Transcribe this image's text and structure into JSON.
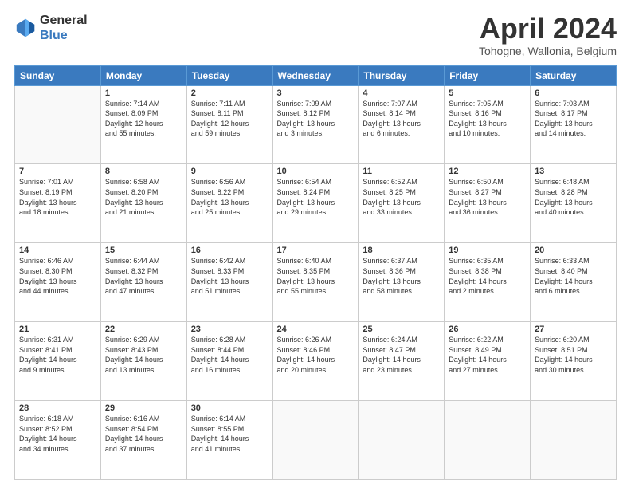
{
  "logo": {
    "line1": "General",
    "line2": "Blue"
  },
  "title": "April 2024",
  "subtitle": "Tohogne, Wallonia, Belgium",
  "header_days": [
    "Sunday",
    "Monday",
    "Tuesday",
    "Wednesday",
    "Thursday",
    "Friday",
    "Saturday"
  ],
  "weeks": [
    [
      {
        "day": "",
        "info": ""
      },
      {
        "day": "1",
        "info": "Sunrise: 7:14 AM\nSunset: 8:09 PM\nDaylight: 12 hours\nand 55 minutes."
      },
      {
        "day": "2",
        "info": "Sunrise: 7:11 AM\nSunset: 8:11 PM\nDaylight: 12 hours\nand 59 minutes."
      },
      {
        "day": "3",
        "info": "Sunrise: 7:09 AM\nSunset: 8:12 PM\nDaylight: 13 hours\nand 3 minutes."
      },
      {
        "day": "4",
        "info": "Sunrise: 7:07 AM\nSunset: 8:14 PM\nDaylight: 13 hours\nand 6 minutes."
      },
      {
        "day": "5",
        "info": "Sunrise: 7:05 AM\nSunset: 8:16 PM\nDaylight: 13 hours\nand 10 minutes."
      },
      {
        "day": "6",
        "info": "Sunrise: 7:03 AM\nSunset: 8:17 PM\nDaylight: 13 hours\nand 14 minutes."
      }
    ],
    [
      {
        "day": "7",
        "info": "Sunrise: 7:01 AM\nSunset: 8:19 PM\nDaylight: 13 hours\nand 18 minutes."
      },
      {
        "day": "8",
        "info": "Sunrise: 6:58 AM\nSunset: 8:20 PM\nDaylight: 13 hours\nand 21 minutes."
      },
      {
        "day": "9",
        "info": "Sunrise: 6:56 AM\nSunset: 8:22 PM\nDaylight: 13 hours\nand 25 minutes."
      },
      {
        "day": "10",
        "info": "Sunrise: 6:54 AM\nSunset: 8:24 PM\nDaylight: 13 hours\nand 29 minutes."
      },
      {
        "day": "11",
        "info": "Sunrise: 6:52 AM\nSunset: 8:25 PM\nDaylight: 13 hours\nand 33 minutes."
      },
      {
        "day": "12",
        "info": "Sunrise: 6:50 AM\nSunset: 8:27 PM\nDaylight: 13 hours\nand 36 minutes."
      },
      {
        "day": "13",
        "info": "Sunrise: 6:48 AM\nSunset: 8:28 PM\nDaylight: 13 hours\nand 40 minutes."
      }
    ],
    [
      {
        "day": "14",
        "info": "Sunrise: 6:46 AM\nSunset: 8:30 PM\nDaylight: 13 hours\nand 44 minutes."
      },
      {
        "day": "15",
        "info": "Sunrise: 6:44 AM\nSunset: 8:32 PM\nDaylight: 13 hours\nand 47 minutes."
      },
      {
        "day": "16",
        "info": "Sunrise: 6:42 AM\nSunset: 8:33 PM\nDaylight: 13 hours\nand 51 minutes."
      },
      {
        "day": "17",
        "info": "Sunrise: 6:40 AM\nSunset: 8:35 PM\nDaylight: 13 hours\nand 55 minutes."
      },
      {
        "day": "18",
        "info": "Sunrise: 6:37 AM\nSunset: 8:36 PM\nDaylight: 13 hours\nand 58 minutes."
      },
      {
        "day": "19",
        "info": "Sunrise: 6:35 AM\nSunset: 8:38 PM\nDaylight: 14 hours\nand 2 minutes."
      },
      {
        "day": "20",
        "info": "Sunrise: 6:33 AM\nSunset: 8:40 PM\nDaylight: 14 hours\nand 6 minutes."
      }
    ],
    [
      {
        "day": "21",
        "info": "Sunrise: 6:31 AM\nSunset: 8:41 PM\nDaylight: 14 hours\nand 9 minutes."
      },
      {
        "day": "22",
        "info": "Sunrise: 6:29 AM\nSunset: 8:43 PM\nDaylight: 14 hours\nand 13 minutes."
      },
      {
        "day": "23",
        "info": "Sunrise: 6:28 AM\nSunset: 8:44 PM\nDaylight: 14 hours\nand 16 minutes."
      },
      {
        "day": "24",
        "info": "Sunrise: 6:26 AM\nSunset: 8:46 PM\nDaylight: 14 hours\nand 20 minutes."
      },
      {
        "day": "25",
        "info": "Sunrise: 6:24 AM\nSunset: 8:47 PM\nDaylight: 14 hours\nand 23 minutes."
      },
      {
        "day": "26",
        "info": "Sunrise: 6:22 AM\nSunset: 8:49 PM\nDaylight: 14 hours\nand 27 minutes."
      },
      {
        "day": "27",
        "info": "Sunrise: 6:20 AM\nSunset: 8:51 PM\nDaylight: 14 hours\nand 30 minutes."
      }
    ],
    [
      {
        "day": "28",
        "info": "Sunrise: 6:18 AM\nSunset: 8:52 PM\nDaylight: 14 hours\nand 34 minutes."
      },
      {
        "day": "29",
        "info": "Sunrise: 6:16 AM\nSunset: 8:54 PM\nDaylight: 14 hours\nand 37 minutes."
      },
      {
        "day": "30",
        "info": "Sunrise: 6:14 AM\nSunset: 8:55 PM\nDaylight: 14 hours\nand 41 minutes."
      },
      {
        "day": "",
        "info": ""
      },
      {
        "day": "",
        "info": ""
      },
      {
        "day": "",
        "info": ""
      },
      {
        "day": "",
        "info": ""
      }
    ]
  ]
}
